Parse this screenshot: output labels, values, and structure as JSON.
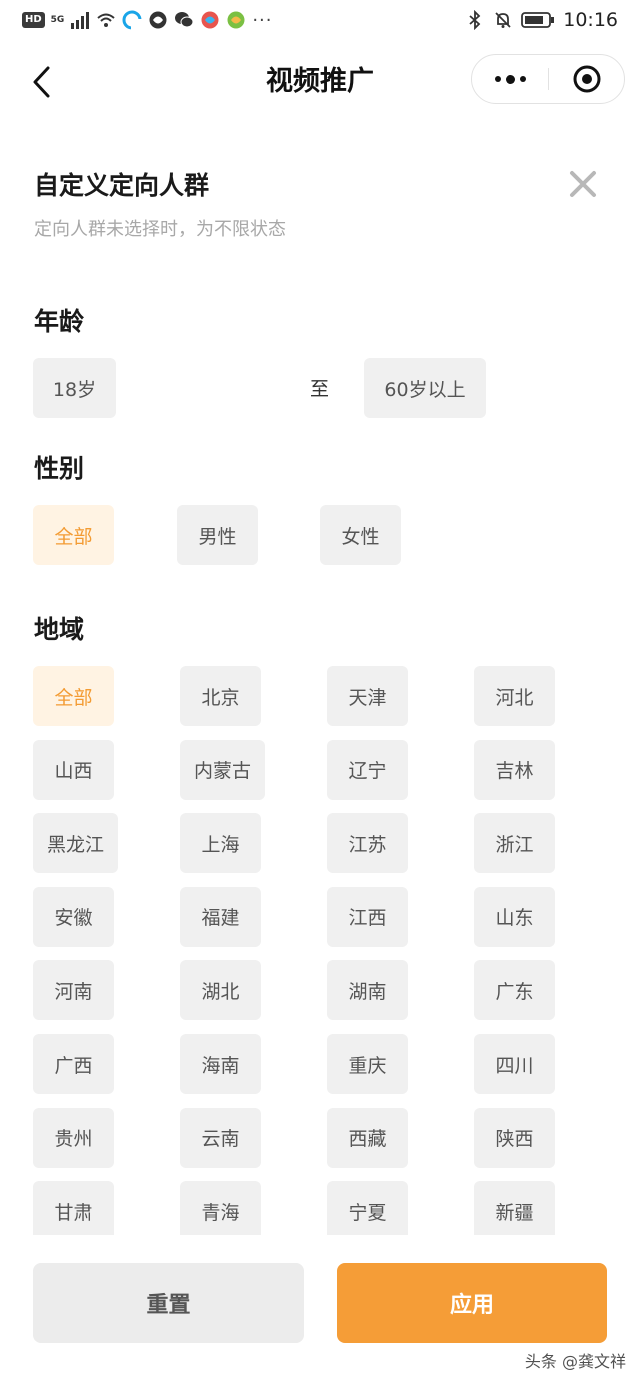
{
  "status_bar": {
    "hd": "HD",
    "network": "5G",
    "dots": "···",
    "time": "10:16"
  },
  "nav": {
    "title": "视频推广"
  },
  "panel": {
    "title": "自定义定向人群",
    "subtitle": "定向人群未选择时，为不限状态"
  },
  "age": {
    "title": "年龄",
    "from": "18岁",
    "to_label": "至",
    "to": "60岁以上"
  },
  "gender": {
    "title": "性别",
    "options": [
      "全部",
      "男性",
      "女性"
    ],
    "selected": "全部"
  },
  "region": {
    "title": "地域",
    "selected": "全部",
    "options": [
      "全部",
      "北京",
      "天津",
      "河北",
      "山西",
      "内蒙古",
      "辽宁",
      "吉林",
      "黑龙江",
      "上海",
      "江苏",
      "浙江",
      "安徽",
      "福建",
      "江西",
      "山东",
      "河南",
      "湖北",
      "湖南",
      "广东",
      "广西",
      "海南",
      "重庆",
      "四川",
      "贵州",
      "云南",
      "西藏",
      "陕西",
      "甘肃",
      "青海",
      "宁夏",
      "新疆"
    ]
  },
  "footer": {
    "reset_label": "重置",
    "apply_label": "应用"
  },
  "watermark": "头条 @龚文祥",
  "colors": {
    "accent": "#f59d37",
    "accent_text": "#f39b33",
    "selected_bg": "#fff3e3",
    "chip_bg": "#f0f0f0"
  }
}
